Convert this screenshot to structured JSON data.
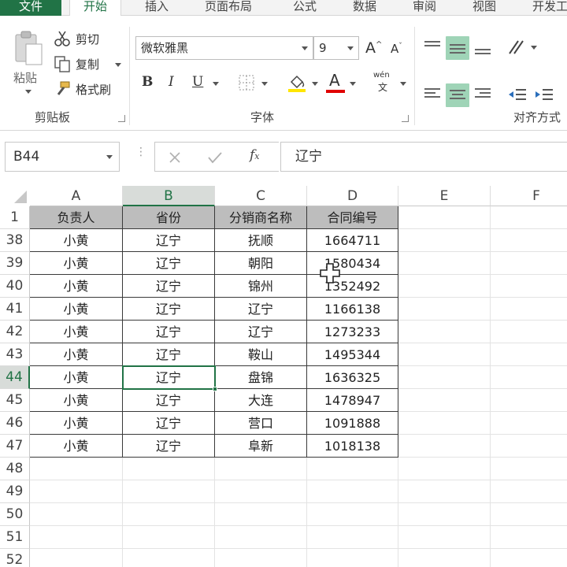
{
  "tabs": [
    {
      "label": "文件"
    },
    {
      "label": "开始"
    },
    {
      "label": "插入"
    },
    {
      "label": "页面布局"
    },
    {
      "label": "公式"
    },
    {
      "label": "数据"
    },
    {
      "label": "审阅"
    },
    {
      "label": "视图"
    },
    {
      "label": "开发工"
    }
  ],
  "clipboard": {
    "paste": "粘贴",
    "cut": "剪切",
    "copy": "复制",
    "format_painter": "格式刷",
    "group_label": "剪贴板"
  },
  "font": {
    "name": "微软雅黑",
    "size": "9",
    "group_label": "字体",
    "bold": "B",
    "italic": "I",
    "underline": "U",
    "font_color_letter": "A",
    "highlight_color": "#ffe600",
    "font_color": "#e00000",
    "phonetic_top": "wén",
    "phonetic_bottom": "文"
  },
  "alignment": {
    "group_label": "对齐方式",
    "active_color": "#9fd4b7"
  },
  "formula_bar": {
    "name_box": "B44",
    "formula": "辽宁"
  },
  "grid": {
    "columns": [
      "A",
      "B",
      "C",
      "D",
      "E",
      "F"
    ],
    "selected_column": "B",
    "selected_row": "44",
    "header_row": {
      "row": "1",
      "cells": [
        "负责人",
        "省份",
        "分销商名称",
        "合同编号"
      ]
    },
    "rows": [
      {
        "row": "38",
        "cells": [
          "小黄",
          "辽宁",
          "抚顺",
          "1664711"
        ]
      },
      {
        "row": "39",
        "cells": [
          "小黄",
          "辽宁",
          "朝阳",
          "1580434"
        ]
      },
      {
        "row": "40",
        "cells": [
          "小黄",
          "辽宁",
          "锦州",
          "1352492"
        ]
      },
      {
        "row": "41",
        "cells": [
          "小黄",
          "辽宁",
          "辽宁",
          "1166138"
        ]
      },
      {
        "row": "42",
        "cells": [
          "小黄",
          "辽宁",
          "辽宁",
          "1273233"
        ]
      },
      {
        "row": "43",
        "cells": [
          "小黄",
          "辽宁",
          "鞍山",
          "1495344"
        ]
      },
      {
        "row": "44",
        "cells": [
          "小黄",
          "辽宁",
          "盘锦",
          "1636325"
        ]
      },
      {
        "row": "45",
        "cells": [
          "小黄",
          "辽宁",
          "大连",
          "1478947"
        ]
      },
      {
        "row": "46",
        "cells": [
          "小黄",
          "辽宁",
          "营口",
          "1091888"
        ]
      },
      {
        "row": "47",
        "cells": [
          "小黄",
          "辽宁",
          "阜新",
          "1018138"
        ]
      }
    ],
    "empty_rows": [
      "48",
      "49",
      "50",
      "51",
      "52"
    ],
    "header_fill": "#bdbdbd",
    "selection_color": "#217346"
  }
}
